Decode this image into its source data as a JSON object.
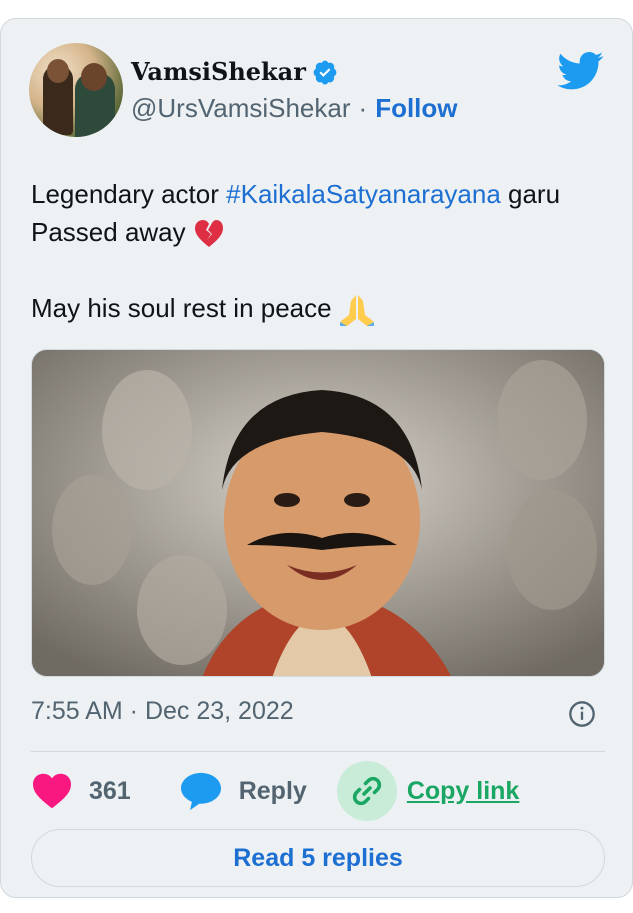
{
  "author": {
    "display_name": "VamsiShekar",
    "handle": "@UrsVamsiShekar",
    "separator": "·",
    "follow_label": "Follow",
    "verified": true
  },
  "tweet": {
    "line1_prefix": "Legendary actor ",
    "line1_hashtag": "#KaikalaSatyanarayana",
    "line1_suffix": " garu",
    "line2": "Passed away",
    "line4": "May his soul rest in peace",
    "emojis": [
      "broken-heart",
      "folded-hands"
    ]
  },
  "meta": {
    "timestamp": "7:55 AM · Dec 23, 2022"
  },
  "actions": {
    "like_count": "361",
    "reply_label": "Reply",
    "copy_link_label": "Copy link"
  },
  "read_replies_label": "Read 5 replies",
  "colors": {
    "card_bg": "#edf1f4",
    "link_blue": "#1d6fd1",
    "twitter_blue": "#1d9bf0",
    "like_pink": "#f91880",
    "copy_green": "#1aa663",
    "muted": "#536471"
  },
  "icons": [
    "verified-badge-icon",
    "twitter-bird-icon",
    "info-icon",
    "heart-icon",
    "reply-bubble-icon",
    "link-icon"
  ]
}
